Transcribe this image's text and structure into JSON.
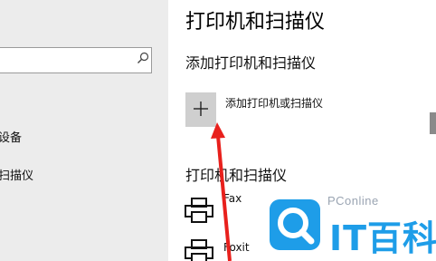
{
  "sidebar": {
    "items": [
      {
        "label": "设备"
      },
      {
        "label": "扫描仪"
      }
    ]
  },
  "main": {
    "title": "打印机和扫描仪",
    "add_section": "添加打印机和扫描仪",
    "add_button_label": "添加打印机或扫描仪",
    "list_section": "打印机和扫描仪",
    "printers": [
      {
        "name": "Fax"
      },
      {
        "name": "Foxit"
      }
    ]
  },
  "icons": {
    "search": "search-icon",
    "add": "plus-icon",
    "printer": "printer-icon"
  },
  "colors": {
    "annotation_arrow": "#e8201c",
    "watermark_blue": "#1e9de8",
    "add_tile": "#cfcfcf",
    "sidebar_bg": "#ececec"
  },
  "watermark": {
    "small": "PConline",
    "big": "IT百科"
  }
}
